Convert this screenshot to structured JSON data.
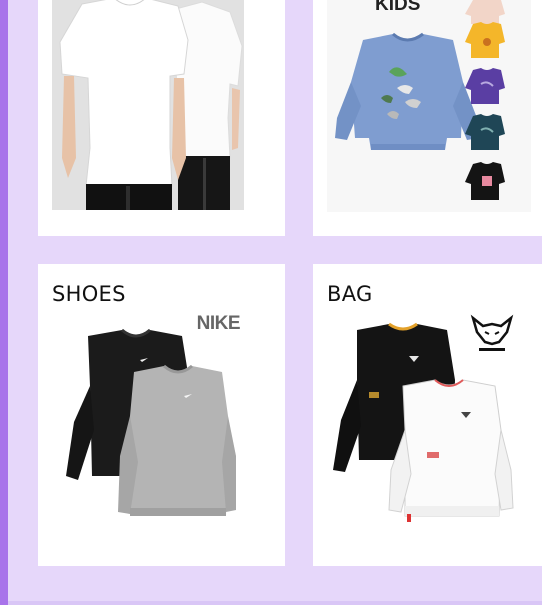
{
  "cards": [
    {
      "label": "",
      "image": "white-tshirt-models-photo"
    },
    {
      "label": "",
      "brand": "KIDS",
      "image": "kids-sweatshirts-photo"
    },
    {
      "label": "SHOES",
      "brand": "NIKE",
      "image": "nike-sweatshirts-photo"
    },
    {
      "label": "BAG",
      "image": "dynafit-sweatshirts-photo"
    }
  ],
  "colors": {
    "background": "#e6d7fa",
    "accent_rail": "#a873ea",
    "card": "#ffffff",
    "label_text": "#111111"
  }
}
